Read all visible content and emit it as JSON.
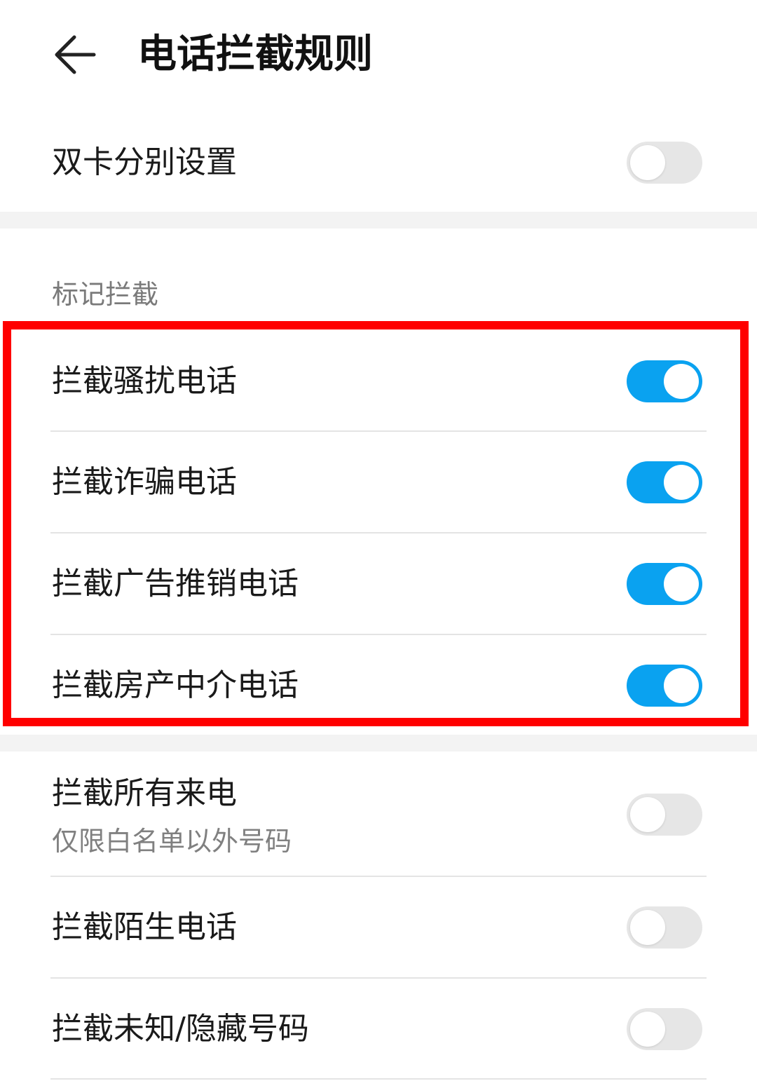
{
  "header": {
    "back_icon": "arrow-left-icon",
    "title": "电话拦截规则"
  },
  "dual_sim": {
    "label": "双卡分别设置",
    "enabled": false
  },
  "mark_section": {
    "title": "标记拦截",
    "highlight_color": "#ff0000",
    "items": [
      {
        "label": "拦截骚扰电话",
        "enabled": true
      },
      {
        "label": "拦截诈骗电话",
        "enabled": true
      },
      {
        "label": "拦截广告推销电话",
        "enabled": true
      },
      {
        "label": "拦截房产中介电话",
        "enabled": true
      }
    ]
  },
  "other_rules": {
    "items": [
      {
        "label": "拦截所有来电",
        "sublabel": "仅限白名单以外号码",
        "enabled": false
      },
      {
        "label": "拦截陌生电话",
        "enabled": false
      },
      {
        "label": "拦截未知/隐藏号码",
        "enabled": false
      }
    ]
  },
  "colors": {
    "toggle_on": "#0aa2f0",
    "toggle_off": "#e6e6e6",
    "section_band": "#f3f3f3"
  }
}
